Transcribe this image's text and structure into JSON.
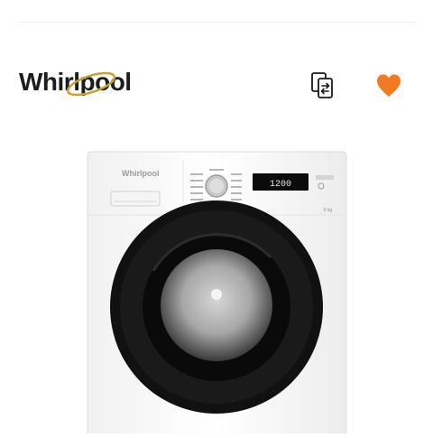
{
  "header": {
    "brand": {
      "name": "Whirlpool"
    },
    "compare": {
      "icon": "compare-icon"
    },
    "favorite": {
      "icon": "heart-icon",
      "color": "#f47a20",
      "active": true
    }
  },
  "product_image": {
    "brand_mark": "Whirlpool",
    "display_reading": "1200",
    "capacity_label": "9 kg",
    "colors": {
      "body": "#ffffff",
      "door_ring": "#101010",
      "accent": "#f47a20"
    }
  }
}
